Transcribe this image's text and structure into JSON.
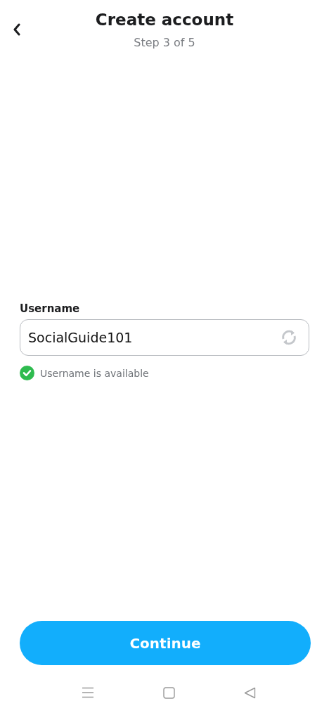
{
  "header": {
    "title": "Create account",
    "subtitle": "Step 3 of 5"
  },
  "username": {
    "label": "Username",
    "value": "SocialGuide101"
  },
  "status": {
    "text": "Username is available",
    "available": true
  },
  "continue_button": {
    "label": "Continue"
  }
}
